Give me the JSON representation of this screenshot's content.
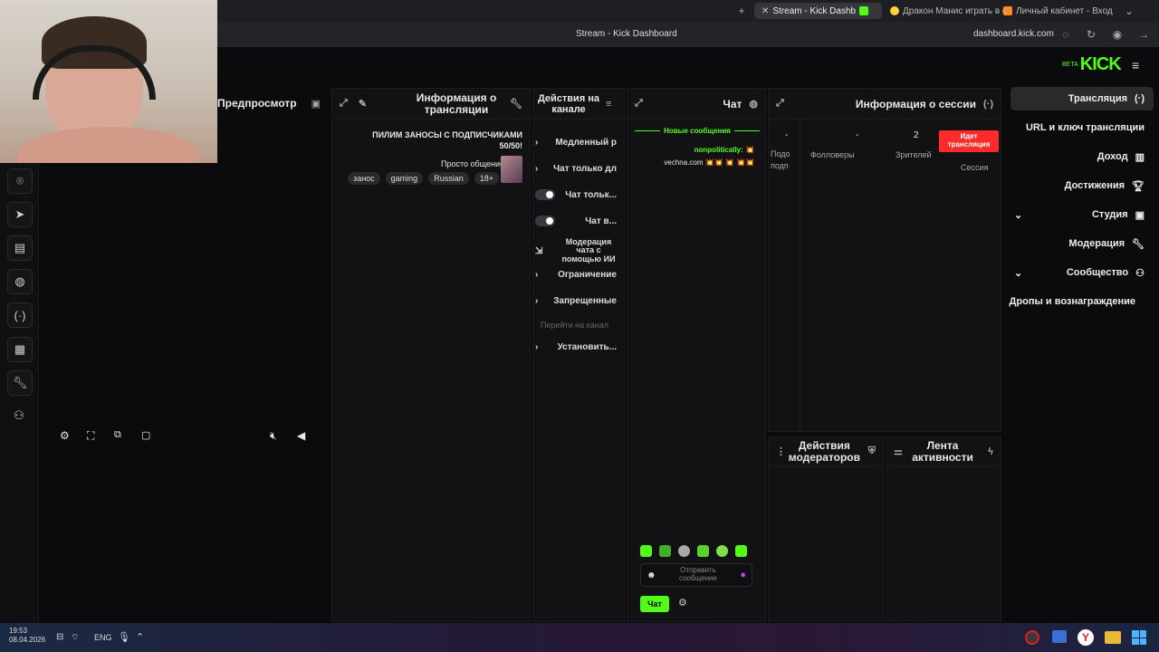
{
  "browser": {
    "tabs": [
      {
        "label": "Личный кабинет - Вход",
        "color": "#ff8a1f"
      },
      {
        "label": "Дракон Манис играть в с",
        "color": "#ffd23a"
      },
      {
        "label": "Stream - Kick Dashb",
        "color": "#53fc18"
      }
    ],
    "page_title": "Stream - Kick Dashboard",
    "address": "dashboard.kick.com"
  },
  "brand": {
    "logo": "KICK",
    "beta": "BETA",
    "accent": "#53fc18"
  },
  "sidebar": {
    "items": [
      {
        "label": "Трансляция",
        "icon": "broadcast-icon",
        "active": true
      },
      {
        "label": "URL и ключ трансляции",
        "icon": "key-icon"
      },
      {
        "label": "Доход",
        "icon": "revenue-icon"
      },
      {
        "label": "Достижения",
        "icon": "trophy-icon"
      },
      {
        "label": "Студия",
        "icon": "studio-icon"
      },
      {
        "label": "Модерация",
        "icon": "wrench-icon"
      },
      {
        "label": "Сообщество",
        "icon": "community-icon"
      },
      {
        "label": "Дропы и вознаграждение",
        "icon": ""
      }
    ]
  },
  "session": {
    "title": "Информация о сессии",
    "live_badge": "Идет трансляция",
    "live_color": "#ff2b2b",
    "session_label": "Сессия",
    "viewers_value": "2",
    "viewers_label": "Зрителей",
    "followers_value": "-",
    "followers_label": "Фолловеры",
    "subs_value": "-",
    "subs_label": "Подо подп"
  },
  "activity": {
    "title": "Лента активности"
  },
  "modactions": {
    "title": "Действия модераторов"
  },
  "chat": {
    "title": "Чат",
    "new_messages": "Новые сообщения",
    "messages": [
      {
        "user": "nonpolitically:",
        "text": "💥"
      },
      {
        "user": "",
        "text": "vechna.com 💥💥 💥 💥💥"
      }
    ],
    "input_placeholder": "Отправить сообщение",
    "send_label": "Чат"
  },
  "channel_actions": {
    "title": "Действия на канале",
    "items": [
      {
        "label": "Медленный р",
        "control": "chevron"
      },
      {
        "label": "Чат только дл",
        "control": "chevron"
      },
      {
        "label": "Чат тольк...",
        "control": "toggle"
      },
      {
        "label": "Чат в...",
        "control": "toggle"
      },
      {
        "label": "Модерация чата с помощью ИИ",
        "control": "external"
      },
      {
        "label": "Ограничение",
        "control": "chevron"
      },
      {
        "label": "Запрещенные",
        "control": "chevron"
      },
      {
        "label": "Перейти на канал",
        "control": "none"
      },
      {
        "label": "Установить...",
        "control": "chevron"
      }
    ]
  },
  "stream_info": {
    "title": "Информация о трансляции",
    "stream_title": "ПИЛИМ ЗАНОСЫ С ПОДПИСЧИКАМИ 50/50!",
    "category": "Просто общение",
    "tags": [
      "18+",
      "Russian",
      "gaming",
      "занос"
    ]
  },
  "preview": {
    "title": "Предпросмотр"
  },
  "taskbar": {
    "time": "19:53",
    "date": "08.04.2026",
    "lang": "ENG"
  }
}
